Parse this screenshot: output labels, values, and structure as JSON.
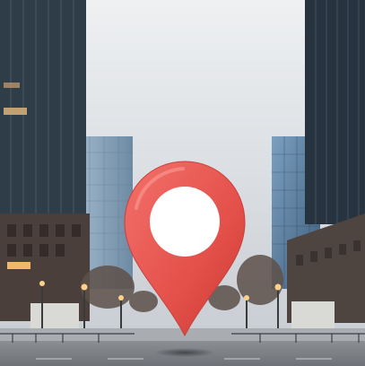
{
  "scene": {
    "description_free": true,
    "colors": {
      "sky_top": "#e9ecef",
      "sky_bottom": "#c7ccd2",
      "tower_dark": "#2c3a46",
      "tower_mid": "#3e5262",
      "tower_glass": "#6f93b4",
      "pin_red": "#e8554f",
      "pin_shadow": "#b8322f",
      "pin_highlight": "#f37d76",
      "pin_hole": "#ffffff",
      "street": "#7b7f84",
      "street_light": "#a6aaaf",
      "trees": "#5a4c45",
      "lamp_glow": "#ffcf83"
    },
    "icons": {
      "location_pin": "map-marker-icon"
    }
  }
}
